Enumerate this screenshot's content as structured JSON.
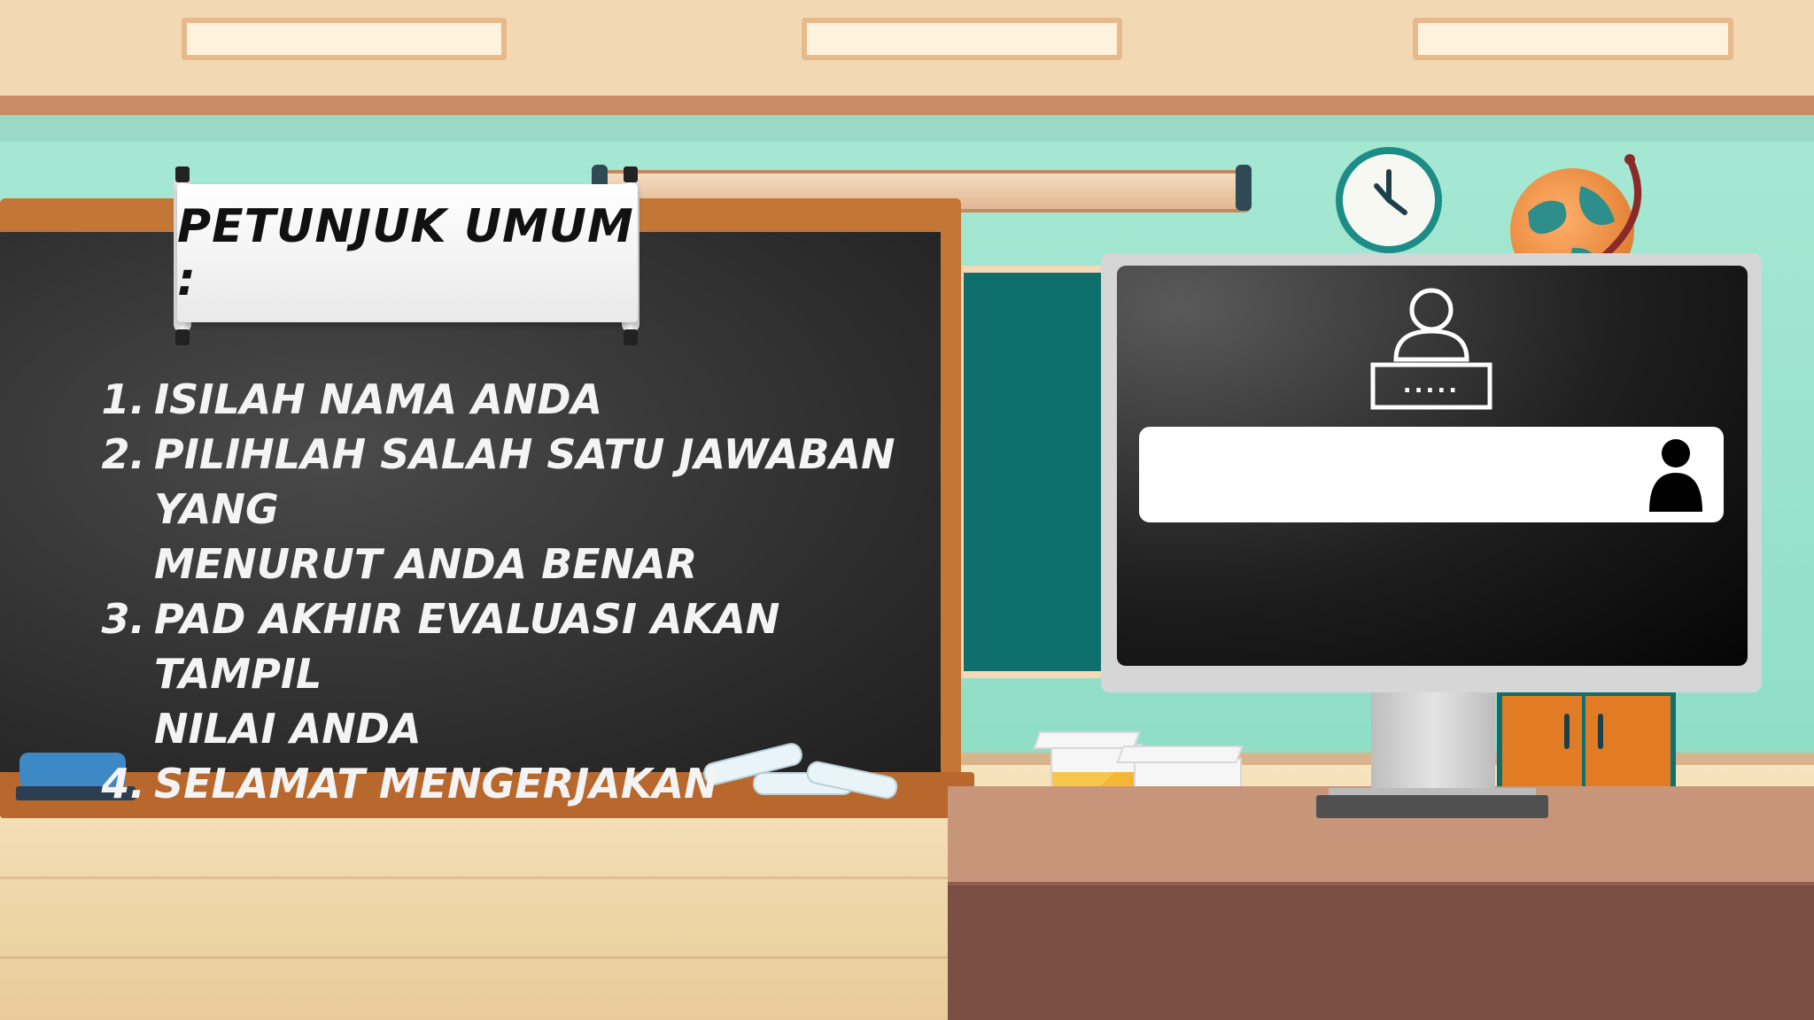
{
  "scroll": {
    "title": "PETUNJUK UMUM :"
  },
  "instructions": [
    {
      "number": "1.",
      "lines": [
        "ISILAH NAMA ANDA"
      ]
    },
    {
      "number": "2.",
      "lines": [
        "PILIHLAH SALAH SATU JAWABAN YANG",
        "MENURUT ANDA BENAR"
      ]
    },
    {
      "number": "3.",
      "lines": [
        "PAD AKHIR EVALUASI AKAN TAMPIL",
        "NILAI ANDA"
      ]
    },
    {
      "number": "4.",
      "lines": [
        "SELAMAT MENGERJAKAN"
      ]
    }
  ],
  "login": {
    "password_mask": ".....",
    "name_input": {
      "value": "",
      "placeholder": ""
    },
    "icons": [
      "login-user-icon",
      "user-icon"
    ]
  },
  "decor_icons": [
    "clock-icon",
    "globe-icon",
    "chalk-icon",
    "eraser-icon"
  ],
  "colors": {
    "wall": "#a6e8d3",
    "blackboard": "#2b2b2b",
    "board_frame": "#c47636",
    "monitor_bezel": "#d6d6d6",
    "screen": "#111111",
    "input": "#ffffff",
    "accent_teal": "#1c8c87"
  }
}
